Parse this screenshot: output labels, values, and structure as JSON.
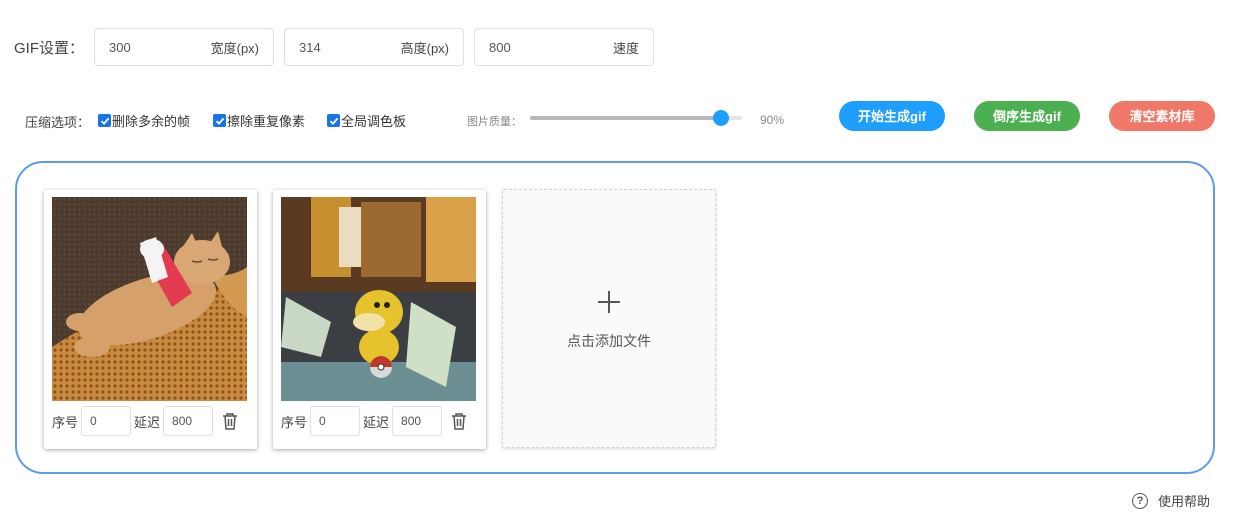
{
  "gif_settings": {
    "label": "GIF设置：",
    "width": {
      "value": "300",
      "suffix": "宽度(px)"
    },
    "height": {
      "value": "314",
      "suffix": "高度(px)"
    },
    "speed": {
      "value": "800",
      "suffix": "速度"
    }
  },
  "compression": {
    "label": "压缩选项：",
    "options": [
      {
        "label": "删除多余的帧",
        "checked": true
      },
      {
        "label": "擦除重复像素",
        "checked": true
      },
      {
        "label": "全局调色板",
        "checked": true
      }
    ],
    "quality": {
      "label": "图片质量：",
      "value": 0.9,
      "value_text": "90%"
    }
  },
  "actions": {
    "start": "开始生成gif",
    "reverse": "倒序生成gif",
    "clear": "清空素材库"
  },
  "frames": [
    {
      "index_label": "序号",
      "index": "0",
      "delay_label": "延迟",
      "delay": "800",
      "image": "kitten-with-bandaged-leg"
    },
    {
      "index_label": "序号",
      "index": "0",
      "delay_label": "延迟",
      "delay": "800",
      "image": "psyduck-figure-toy"
    }
  ],
  "add_file": {
    "icon": "plus-icon",
    "label": "点击添加文件"
  },
  "help": {
    "icon": "question-circle-icon",
    "label": "使用帮助"
  },
  "colors": {
    "primary": "#1e9fff",
    "success": "#4caf50",
    "danger": "#f07869",
    "frame_border": "#5b9bf0"
  }
}
